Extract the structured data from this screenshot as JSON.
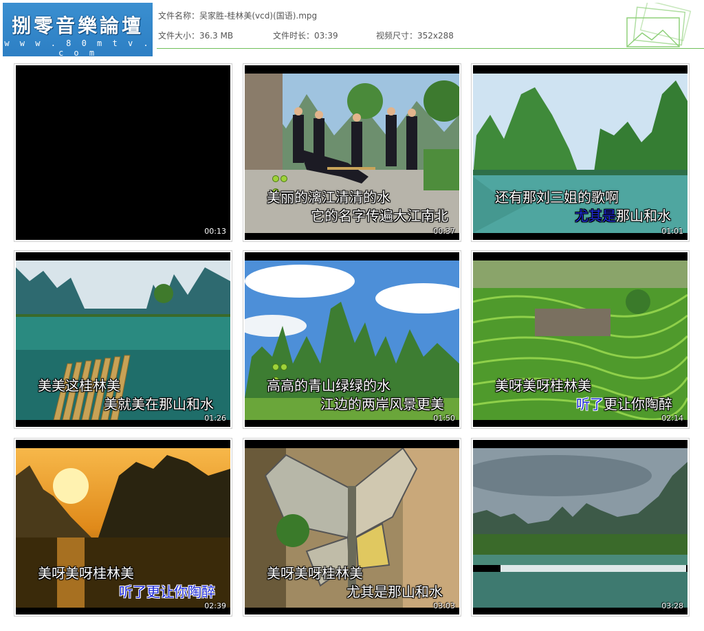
{
  "logo": {
    "title": "捌零音樂論壇",
    "url": "w w w . 8 0 m t v . c o m"
  },
  "file": {
    "name_label": "文件名称：",
    "name": "吴家胜-桂林美(vcd)(国语).mpg",
    "size_label": "文件大小：",
    "size": "36.3 MB",
    "duration_label": "文件时长：",
    "duration": "03:39",
    "dims_label": "视频尺寸：",
    "dims": "352x288"
  },
  "colors": {
    "accent_line": "#6fbf5a",
    "logo_bg": "#2d7fc4",
    "lyric_highlight": "#1e2ad8"
  },
  "thumbnails": [
    {
      "time": "00:13",
      "line1": "",
      "line2": ""
    },
    {
      "time": "00:37",
      "line1": "美丽的漓江清清的水",
      "line2": "它的名字传遍大江南北"
    },
    {
      "time": "01:01",
      "line1": "还有那刘三姐的歌啊",
      "line2": "尤其是那山和水",
      "line2_hl": "尤其是",
      "line2_rest": "那山和水"
    },
    {
      "time": "01:26",
      "line1": "美美这桂林美",
      "line2": "美就美在那山和水"
    },
    {
      "time": "01:50",
      "line1": "高高的青山绿绿的水",
      "line2": "江边的两岸风景更美"
    },
    {
      "time": "02:14",
      "line1": "美呀美呀桂林美",
      "line2": "听了更让你陶醉",
      "line2_hl": "听了",
      "line2_rest": "更让你陶醉"
    },
    {
      "time": "02:39",
      "line1": "美呀美呀桂林美",
      "line2": "听了更让你陶醉",
      "line2_hl": "听了更让你陶醉",
      "line2_rest": ""
    },
    {
      "time": "03:03",
      "line1": "美呀美呀桂林美",
      "line2": "尤其是那山和水"
    },
    {
      "time": "03:28",
      "line1": "",
      "line2": ""
    }
  ]
}
